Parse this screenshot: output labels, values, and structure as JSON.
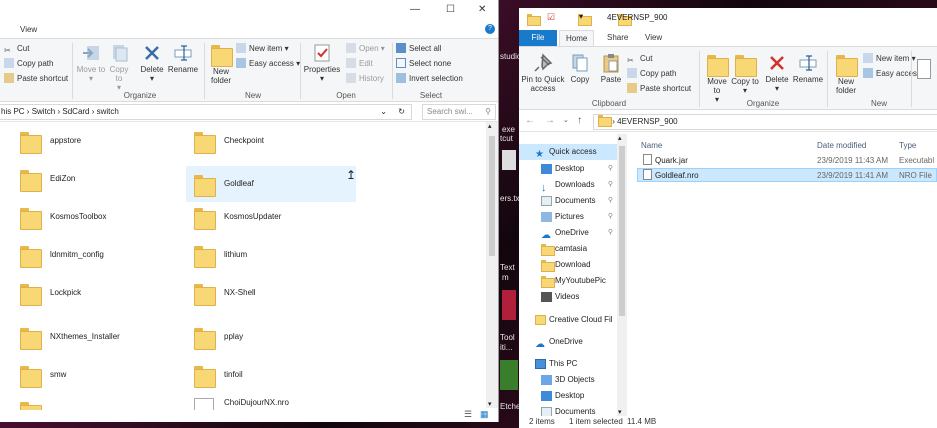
{
  "desktop": {
    "labels": [
      "studio",
      "exe",
      "tcut",
      "ers.txt",
      "Text",
      "m",
      "Tool",
      "iti...",
      "Etche"
    ]
  },
  "left_window": {
    "tab_view": "View",
    "clipboard": {
      "cut": "Cut",
      "copy_path": "Copy path",
      "paste_shortcut": "Paste shortcut"
    },
    "organize": {
      "label": "Organize",
      "move_to": "Move to",
      "copy_to": "Copy to",
      "delete": "Delete",
      "rename": "Rename"
    },
    "new": {
      "label": "New",
      "new_folder": "New folder",
      "new_item": "New item",
      "easy_access": "Easy access"
    },
    "open": {
      "label": "Open",
      "properties": "Properties",
      "open": "Open",
      "edit": "Edit",
      "history": "History"
    },
    "select": {
      "label": "Select",
      "select_all": "Select all",
      "select_none": "Select none",
      "invert_selection": "Invert selection"
    },
    "address": {
      "crumbs": [
        "his PC",
        "Switch",
        "SdCard",
        "switch"
      ]
    },
    "search_placeholder": "Search swi...",
    "items_col1": [
      "appstore",
      "EdiZon",
      "KosmosToolbox",
      "ldnmitm_config",
      "Lockpick",
      "NXthemes_Installer",
      "smw"
    ],
    "items_col2": [
      "Checkpoint",
      "Goldleaf",
      "KosmosUpdater",
      "lithium",
      "NX-Shell",
      "pplay",
      "tinfoil",
      "ChoiDujourNX.nro"
    ]
  },
  "right_window": {
    "title": "4EVERNSP_900",
    "tabs": {
      "file": "File",
      "home": "Home",
      "share": "Share",
      "view": "View"
    },
    "clipboard": {
      "label": "Clipboard",
      "pin": "Pin to Quick access",
      "copy": "Copy",
      "paste": "Paste",
      "cut": "Cut",
      "copy_path": "Copy path",
      "paste_shortcut": "Paste shortcut"
    },
    "organize": {
      "label": "Organize",
      "move_to": "Move to",
      "copy_to": "Copy to",
      "delete": "Delete",
      "rename": "Rename"
    },
    "new": {
      "label": "New",
      "new_folder": "New folder",
      "new_item": "New item",
      "easy_access": "Easy access"
    },
    "address": "4EVERNSP_900",
    "nav": {
      "quick_access": "Quick access",
      "desktop": "Desktop",
      "downloads": "Downloads",
      "documents": "Documents",
      "pictures": "Pictures",
      "onedrive_pinned": "OneDrive",
      "camtasia": "camtasia",
      "download": "Download",
      "myyoutubepic": "MyYoutubePic",
      "videos": "Videos",
      "creative_cloud": "Creative Cloud Fil",
      "onedrive": "OneDrive",
      "this_pc": "This PC",
      "objects3d": "3D Objects",
      "desktop2": "Desktop",
      "documents2": "Documents"
    },
    "columns": {
      "name": "Name",
      "date": "Date modified",
      "type": "Type"
    },
    "files": [
      {
        "name": "Quark.jar",
        "date": "23/9/2019 11:43 AM",
        "type": "Executabl"
      },
      {
        "name": "Goldleaf.nro",
        "date": "23/9/2019 11:41 AM",
        "type": "NRO File"
      }
    ],
    "status": {
      "items": "2 items",
      "selected": "1 item selected",
      "size": "11.4 MB"
    }
  }
}
